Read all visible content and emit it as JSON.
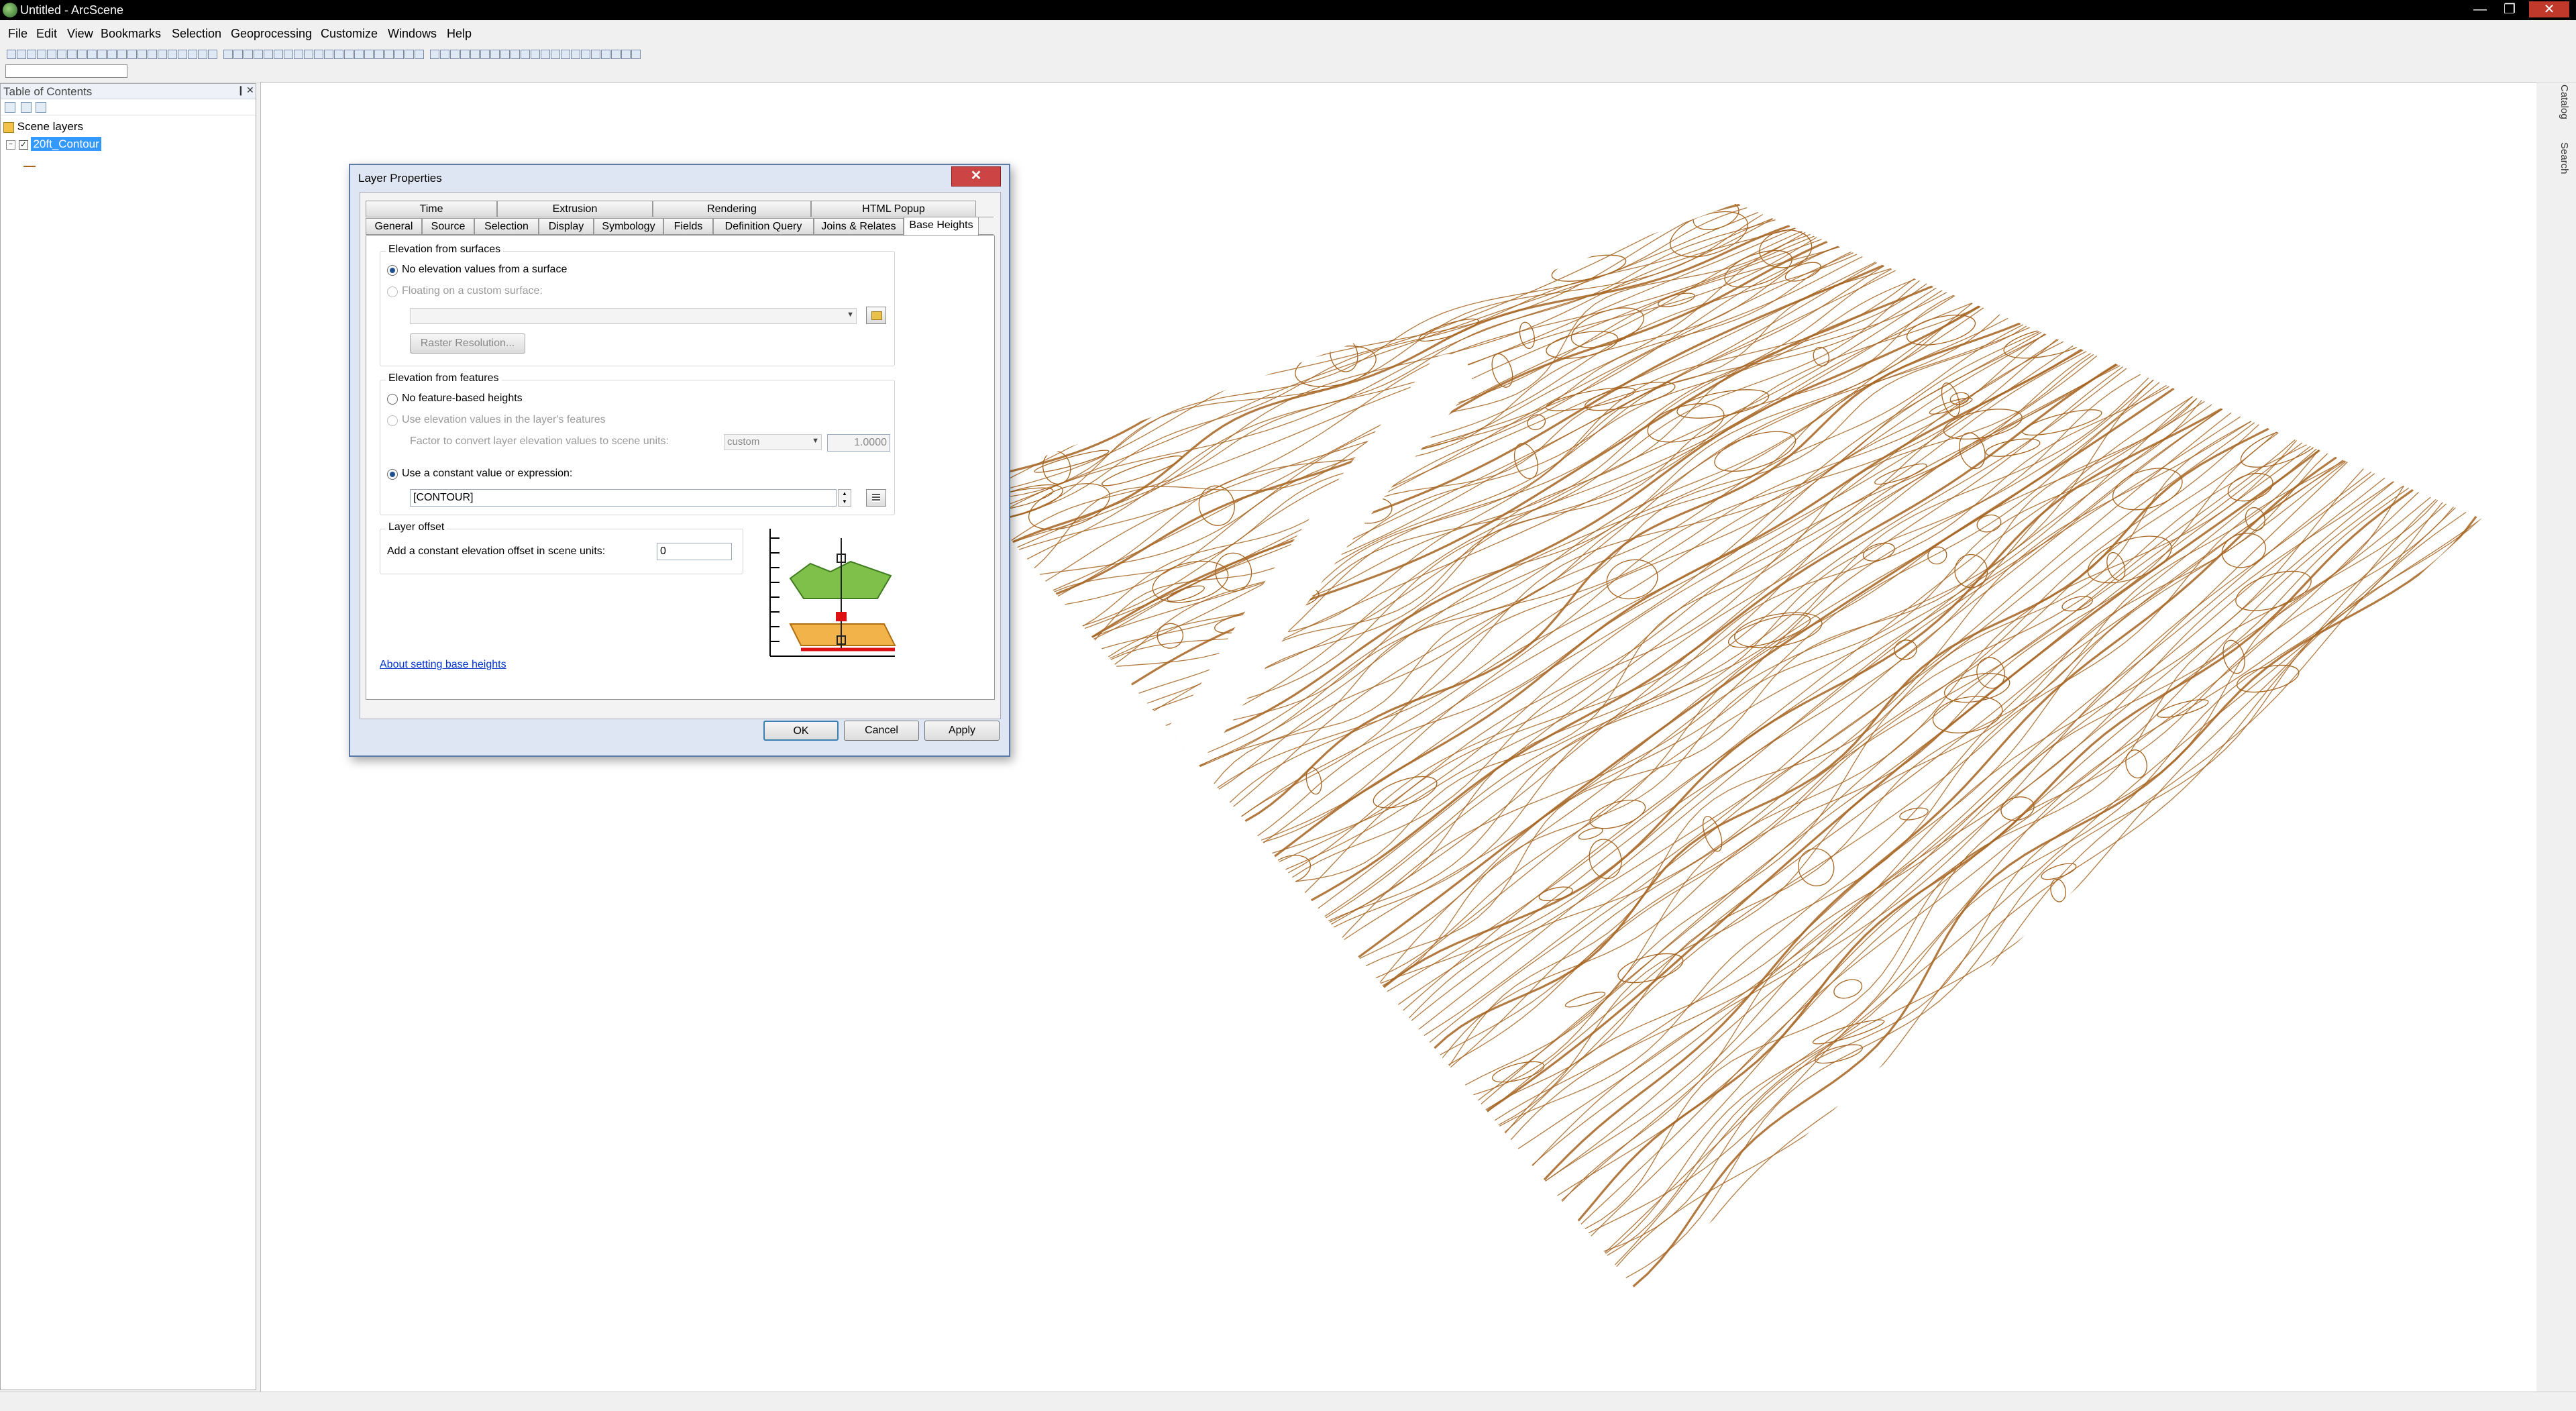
{
  "window": {
    "title": "Untitled - ArcScene",
    "minimize": "—",
    "maximize": "❐",
    "close": "✕"
  },
  "menu": [
    "File",
    "Edit",
    "View",
    "Bookmarks",
    "Selection",
    "Geoprocessing",
    "Customize",
    "Windows",
    "Help"
  ],
  "toc": {
    "title": "Table of Contents",
    "pin": "❙",
    "close": "✕",
    "root_label": "Scene layers",
    "layer_name": "20ft_Contour"
  },
  "side_tabs": [
    "Catalog",
    "Search"
  ],
  "dialog": {
    "title": "Layer Properties",
    "close": "✕",
    "tabs_top": [
      "Time",
      "Extrusion",
      "Rendering",
      "HTML Popup"
    ],
    "tabs_bottom": [
      "General",
      "Source",
      "Selection",
      "Display",
      "Symbology",
      "Fields",
      "Definition Query",
      "Joins & Relates",
      "Base Heights"
    ],
    "active_tab": "Base Heights",
    "elev_surfaces": {
      "title": "Elevation from surfaces",
      "opt_none": "No elevation values from a surface",
      "opt_float": "Floating on a custom surface:",
      "surface_value": "",
      "raster_button": "Raster Resolution..."
    },
    "elev_features": {
      "title": "Elevation from features",
      "opt_none": "No feature-based heights",
      "opt_use": "Use elevation values in the layer's features",
      "factor_label": "Factor to convert layer elevation values to scene units:",
      "unit_value": "custom",
      "factor_value": "1.0000",
      "opt_expr": "Use a constant value or expression:",
      "expression_value": "[CONTOUR]"
    },
    "offset": {
      "title": "Layer offset",
      "label": "Add a constant elevation offset in scene units:",
      "value": "0"
    },
    "help_link": "About setting base heights",
    "buttons": {
      "ok": "OK",
      "cancel": "Cancel",
      "apply": "Apply"
    }
  },
  "colors": {
    "contour": "#a5631e",
    "title_bar": "#000000",
    "selection": "#3399ff",
    "dialog_frame": "#dde6f2"
  }
}
